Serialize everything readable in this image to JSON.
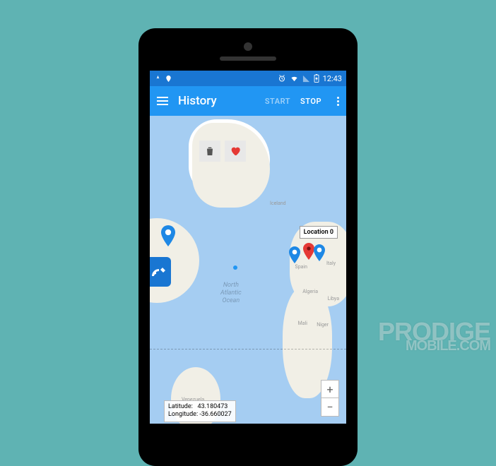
{
  "status_bar": {
    "time": "12:43"
  },
  "app_bar": {
    "title": "History",
    "start": "START",
    "stop": "STOP"
  },
  "map": {
    "ocean_label": "North\nAtlantic\nOcean",
    "location_bubble": "Location 0",
    "labels": {
      "iceland": "Iceland",
      "spain": "Spain",
      "italy": "Italy",
      "algeria": "Algeria",
      "libya": "Libya",
      "mali": "Mali",
      "niger": "Niger",
      "venezuela": "Venezuela"
    }
  },
  "coords": {
    "lat_label": "Latitude:",
    "lat_value": "43.180473",
    "lng_label": "Longitude:",
    "lng_value": "-36.660027"
  },
  "zoom": {
    "in": "+",
    "out": "−"
  },
  "watermark": {
    "line1": "PRODIGE",
    "line2": "MOBILE.COM"
  }
}
